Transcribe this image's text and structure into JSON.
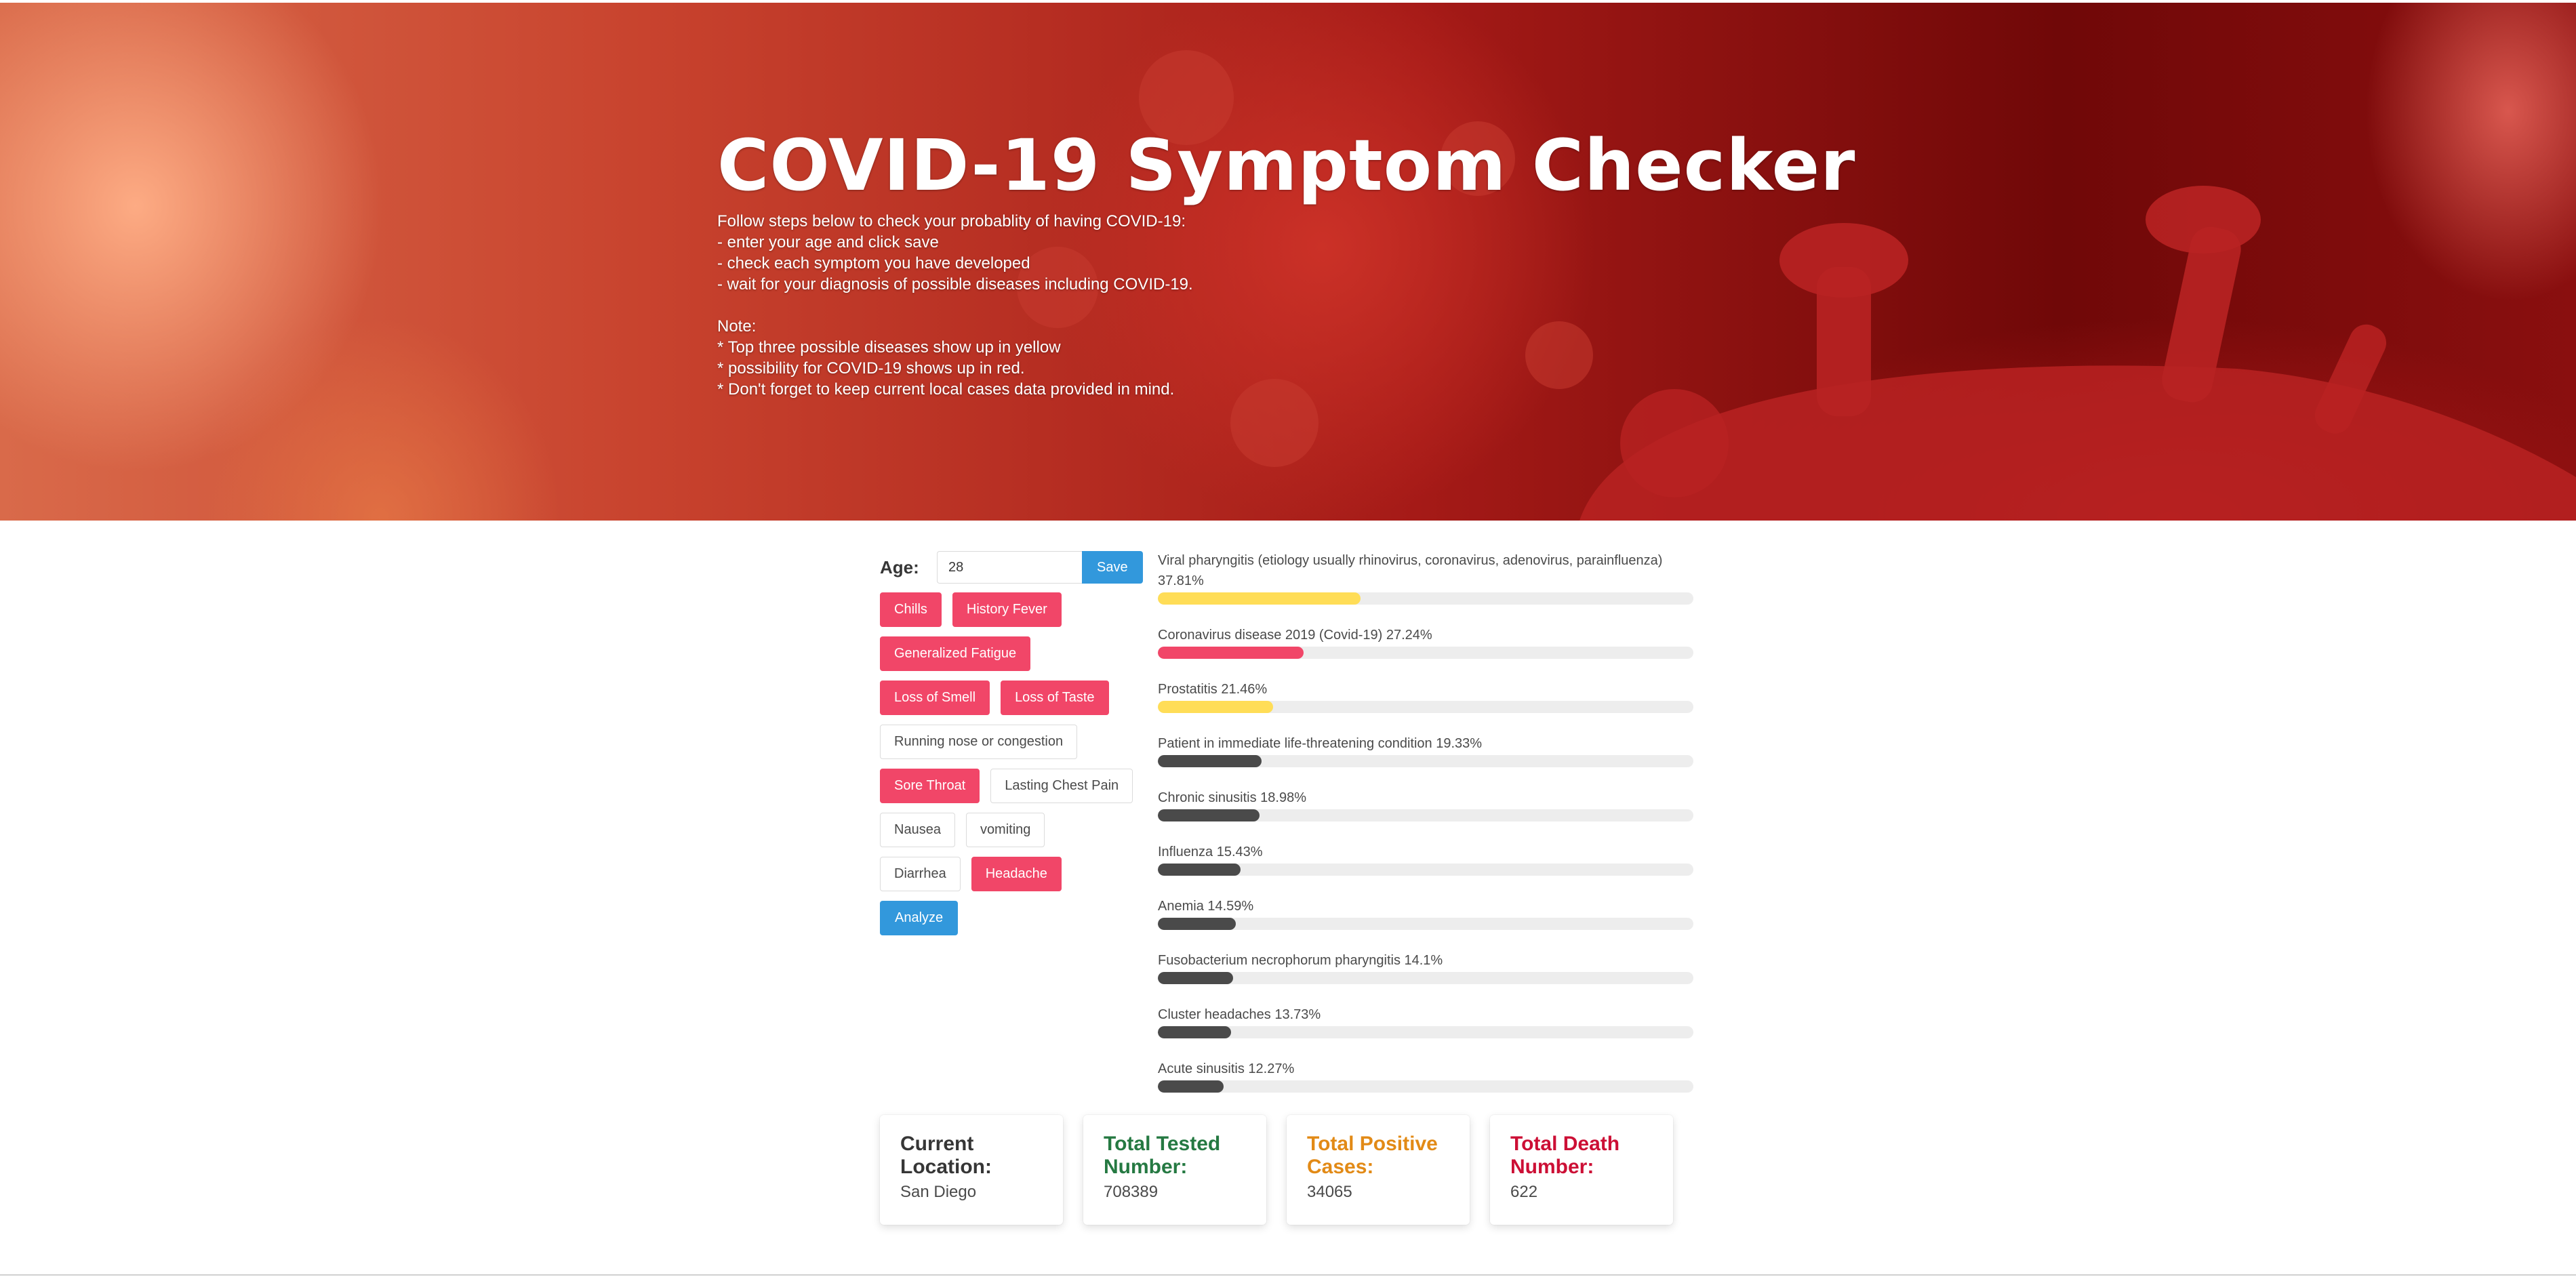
{
  "hero": {
    "title": "COVID-19 Symptom Checker",
    "lines": [
      "Follow steps below to check your probablity of having COVID-19:",
      "- enter your age and click save",
      "- check each symptom you have developed",
      "- wait for your diagnosis of possible diseases including COVID-19.",
      "",
      "Note:",
      "* Top three possible diseases show up in yellow",
      "* possibility for COVID-19 shows up in red.",
      "* Don't forget to keep current local cases data provided in mind."
    ]
  },
  "age": {
    "label": "Age:",
    "value": "28",
    "save_label": "Save"
  },
  "symptoms": [
    {
      "label": "Chills",
      "active": true
    },
    {
      "label": "History Fever",
      "active": true
    },
    {
      "label": "Generalized Fatigue",
      "active": true
    },
    {
      "label": "Loss of Smell",
      "active": true
    },
    {
      "label": "Loss of Taste",
      "active": true
    },
    {
      "label": "Running nose or congestion",
      "active": false
    },
    {
      "label": "Sore Throat",
      "active": true
    },
    {
      "label": "Lasting Chest Pain",
      "active": false
    },
    {
      "label": "Nausea",
      "active": false
    },
    {
      "label": "vomiting",
      "active": false
    },
    {
      "label": "Diarrhea",
      "active": false
    },
    {
      "label": "Headache",
      "active": true
    }
  ],
  "analyze_label": "Analyze",
  "results": [
    {
      "label": "Viral pharyngitis (etiology usually rhinovirus, coronavirus, adenovirus, parainfluenza) 37.81%",
      "percent": 37.81,
      "color": "#ffdd57"
    },
    {
      "label": "Coronavirus disease 2019 (Covid-19) 27.24%",
      "percent": 27.24,
      "color": "#f14668"
    },
    {
      "label": "Prostatitis 21.46%",
      "percent": 21.46,
      "color": "#ffdd57"
    },
    {
      "label": "Patient in immediate life-threatening condition 19.33%",
      "percent": 19.33,
      "color": "#4a4a4a"
    },
    {
      "label": "Chronic sinusitis 18.98%",
      "percent": 18.98,
      "color": "#4a4a4a"
    },
    {
      "label": "Influenza 15.43%",
      "percent": 15.43,
      "color": "#4a4a4a"
    },
    {
      "label": "Anemia 14.59%",
      "percent": 14.59,
      "color": "#4a4a4a"
    },
    {
      "label": "Fusobacterium necrophorum pharyngitis 14.1%",
      "percent": 14.1,
      "color": "#4a4a4a"
    },
    {
      "label": "Cluster headaches 13.73%",
      "percent": 13.73,
      "color": "#4a4a4a"
    },
    {
      "label": "Acute sinusitis 12.27%",
      "percent": 12.27,
      "color": "#4a4a4a"
    }
  ],
  "stats": [
    {
      "title": "Current Location:",
      "value": "San Diego",
      "color": "#363636"
    },
    {
      "title": "Total Tested Number:",
      "value": "708389",
      "color": "#257942"
    },
    {
      "title": "Total Positive Cases:",
      "value": "34065",
      "color": "#e28a16"
    },
    {
      "title": "Total Death Number:",
      "value": "622",
      "color": "#cc0f35"
    }
  ]
}
